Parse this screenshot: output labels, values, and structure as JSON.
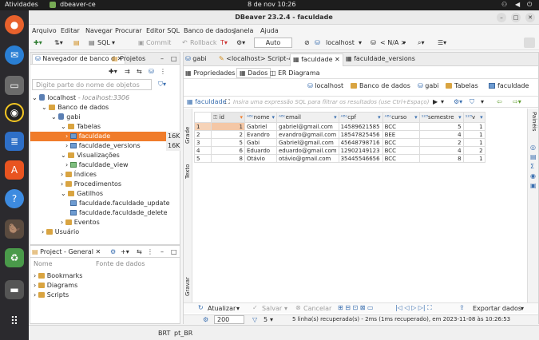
{
  "system_bar": {
    "activities": "Atividades",
    "app": "dbeaver-ce",
    "datetime": "8 de nov  10:26"
  },
  "window": {
    "title": "DBeaver 23.2.4 - faculdade"
  },
  "menu": [
    "Arquivo",
    "Editar",
    "Navegar",
    "Procurar",
    "Editor SQL",
    "Banco de dados",
    "Janela",
    "Ajuda"
  ],
  "toolbar": {
    "sql": "SQL",
    "commit": "Commit",
    "rollback": "Rollback",
    "mode": "Auto",
    "connection": "localhost",
    "schema": "< N/A >"
  },
  "navigator": {
    "tab_active": "Navegador de banco d",
    "tab_projects": "Projetos",
    "filter_placeholder": "Digite parte do nome de objetos",
    "connection": "localhost",
    "connection_host": "- localhost:3306",
    "databases": "Banco de dados",
    "schema": "gabi",
    "tables": "Tabelas",
    "table1": "faculdade",
    "table1_size": "16K",
    "table2": "faculdade_versions",
    "table2_size": "16K",
    "views": "Visualizações",
    "view1": "faculdade_view",
    "indexes": "Índices",
    "procedures": "Procedimentos",
    "triggers": "Gatilhos",
    "trigger1": "faculdade.faculdade_update",
    "trigger2": "faculdade.faculdade_delete",
    "events": "Eventos",
    "users": "Usuário"
  },
  "project": {
    "tab": "Project - General",
    "col_name": "Nome",
    "col_source": "Fonte de dados",
    "items": [
      "Bookmarks",
      "Diagrams",
      "Scripts"
    ]
  },
  "editor_tabs": [
    "gabi",
    "<localhost> Script-4",
    "faculdade",
    "faculdade_versions"
  ],
  "sub_tabs": [
    "Propriedades",
    "Dados",
    "ER Diagrama"
  ],
  "breadcrumb": [
    "localhost",
    "Banco de dados",
    "gabi",
    "Tabelas",
    "faculdade"
  ],
  "filter": {
    "table": "faculdade",
    "placeholder": "Insira uma expressão SQL para filtrar os resultados (use Ctrl+Espaço)"
  },
  "side_labels": {
    "grid": "Grade",
    "text": "Texto",
    "record": "Gravar",
    "panels": "Painéis"
  },
  "columns": [
    "id",
    "nome",
    "email",
    "cpf",
    "curso",
    "semestre",
    "v"
  ],
  "rows": [
    [
      "1",
      "1",
      "Gabriel",
      "gabriel@gmail.com",
      "14589621585",
      "BCC",
      "5",
      "1"
    ],
    [
      "2",
      "2",
      "Evandro",
      "evandro@gmail.com",
      "18547825456",
      "BEE",
      "4",
      "1"
    ],
    [
      "3",
      "5",
      "Gabi",
      "Gabriel@gmail.com",
      "45648798716",
      "BCC",
      "2",
      "1"
    ],
    [
      "4",
      "6",
      "Eduardo",
      "eduardo@gmail.com",
      "12902149123",
      "BCC",
      "4",
      "2"
    ],
    [
      "5",
      "8",
      "Otávio",
      "otávio@gmail.com",
      "35445546656",
      "BCC",
      "8",
      "1"
    ]
  ],
  "bottom_bar": {
    "refresh": "Atualizar",
    "save": "Salvar",
    "cancel": "Cancelar",
    "export": "Exportar dados"
  },
  "status": {
    "fetch_size": "200",
    "count": "5",
    "message": "5 linha(s) recuperada(s) - 2ms (1ms recuperado), em 2023-11-08 às 10:26:53"
  },
  "footer": {
    "tz": "BRT",
    "locale": "pt_BR"
  }
}
